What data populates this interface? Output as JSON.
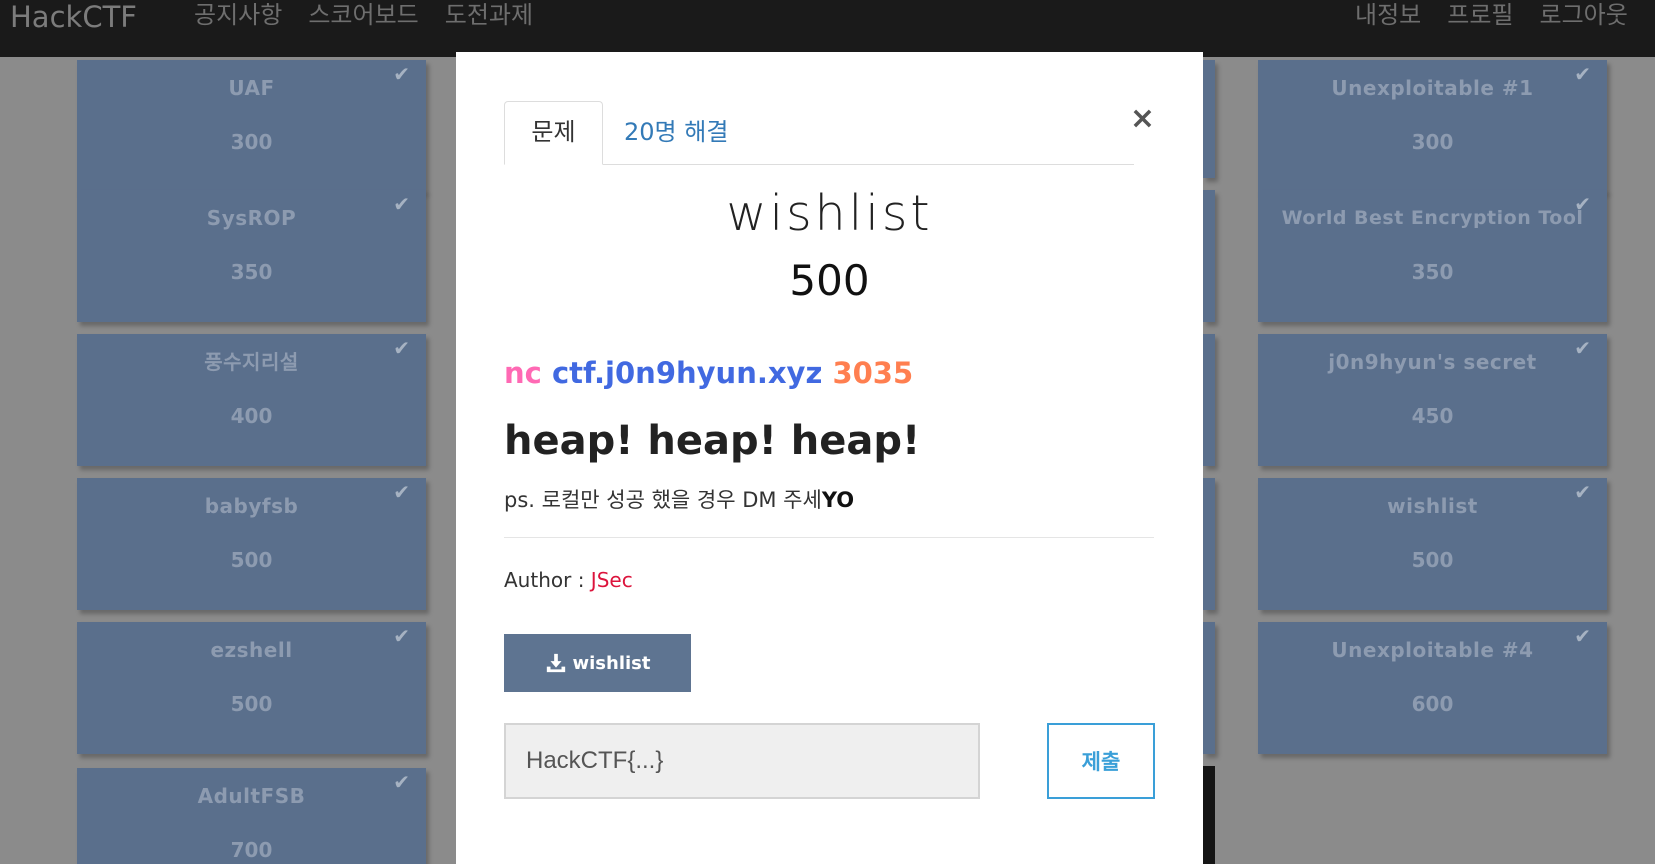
{
  "nav": {
    "brand": "HackCTF",
    "left_links": [
      "공지사항",
      "스코어보드",
      "도전과제"
    ],
    "right_links": [
      "내정보",
      "프로필",
      "로그아웃"
    ]
  },
  "left_cards": [
    {
      "name": "UAF",
      "score": "300"
    },
    {
      "name": "SysROP",
      "score": "350"
    },
    {
      "name": "풍수지리설",
      "score": "400"
    },
    {
      "name": "babyfsb",
      "score": "500"
    },
    {
      "name": "ezshell",
      "score": "500"
    },
    {
      "name": "AdultFSB",
      "score": "700"
    }
  ],
  "right_cards": [
    {
      "name": "Unexploitable #1",
      "score": "300"
    },
    {
      "name": "World Best Encryption Tool",
      "score": "350"
    },
    {
      "name": "j0n9hyun's secret",
      "score": "450"
    },
    {
      "name": "wishlist",
      "score": "500"
    },
    {
      "name": "Unexploitable #4",
      "score": "600"
    }
  ],
  "check_glyph": "✔",
  "modal": {
    "tab_problem": "문제",
    "tab_solves": "20명 해결",
    "close": "×",
    "title": "wishlist",
    "score": "500",
    "nc_cmd": "nc",
    "nc_host": "ctf.j0n9hyun.xyz",
    "nc_port": "3035",
    "heading": "heap! heap! heap!",
    "ps_text": "ps. 로컬만 성공 했을 경우 DM 주세",
    "ps_bold": "YO",
    "author_label": "Author : ",
    "author_name": "JSec",
    "download_label": "wishlist",
    "flag_placeholder": "HackCTF{...}",
    "submit_label": "제출"
  },
  "colors": {
    "nc": "#ff69b4",
    "host": "#4169e1",
    "port": "#ff7f50",
    "author": "#dc143c",
    "tab_link": "#337ab7",
    "download_button": "#5e7491",
    "submit": "#3a9fd8"
  }
}
